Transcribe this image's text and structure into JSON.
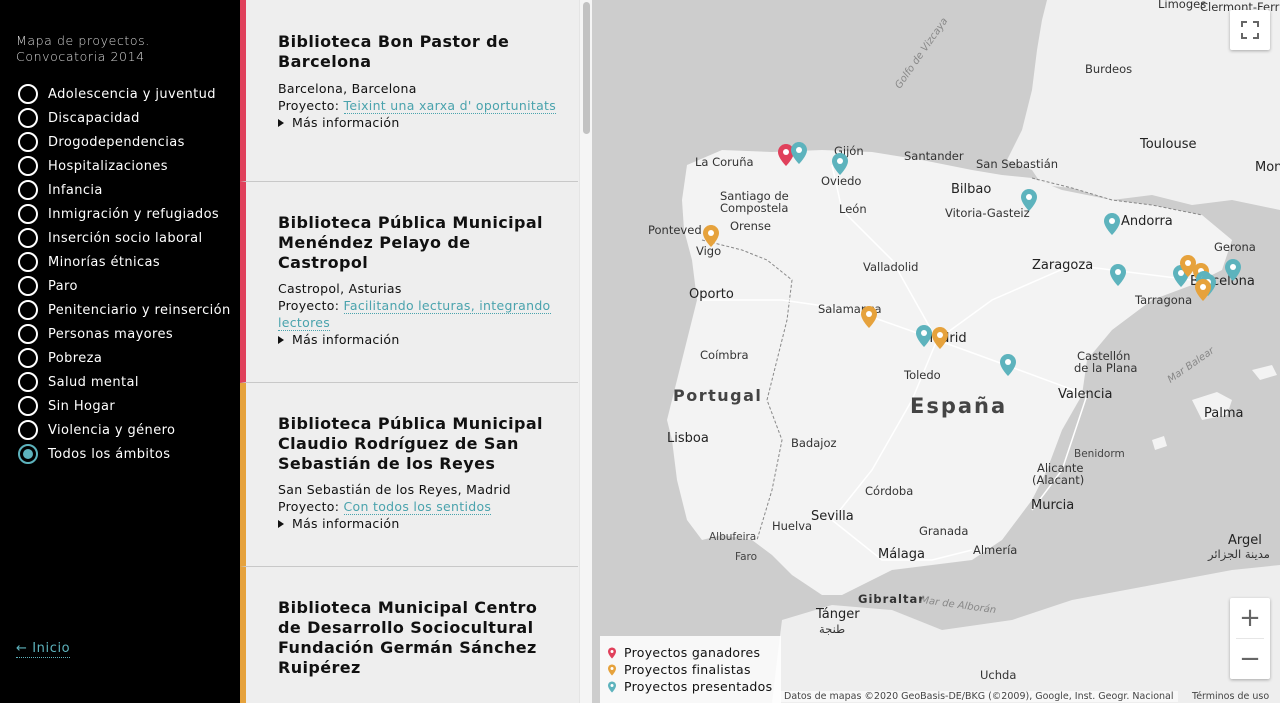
{
  "sidebar": {
    "title_line1": "Mapa de proyectos.",
    "title_line2": "Convocatoria 2014",
    "filters": [
      {
        "label": "Adolescencia y juventud",
        "checked": false
      },
      {
        "label": "Discapacidad",
        "checked": false
      },
      {
        "label": "Drogodependencias",
        "checked": false
      },
      {
        "label": "Hospitalizaciones",
        "checked": false
      },
      {
        "label": "Infancia",
        "checked": false
      },
      {
        "label": "Inmigración y refugiados",
        "checked": false
      },
      {
        "label": "Inserción socio laboral",
        "checked": false
      },
      {
        "label": "Minorías étnicas",
        "checked": false
      },
      {
        "label": "Paro",
        "checked": false
      },
      {
        "label": "Penitenciario y reinserción",
        "checked": false
      },
      {
        "label": "Personas mayores",
        "checked": false
      },
      {
        "label": "Pobreza",
        "checked": false
      },
      {
        "label": "Salud mental",
        "checked": false
      },
      {
        "label": "Sin Hogar",
        "checked": false
      },
      {
        "label": "Violencia y género",
        "checked": false
      },
      {
        "label": "Todos los ámbitos",
        "checked": true
      }
    ],
    "home_link": "← Inicio"
  },
  "cards": [
    {
      "title": "Biblioteca Bon Pastor de Barcelona",
      "place": "Barcelona, Barcelona",
      "project_prefix": "Proyecto: ",
      "project_name": "Teixint una xarxa d' oportunitats",
      "more": "Más información",
      "status": "ganador",
      "status_color": "#e0405b"
    },
    {
      "title": "Biblioteca Pública Municipal Menéndez Pelayo de Castropol",
      "place": "Castropol, Asturias",
      "project_prefix": "Proyecto: ",
      "project_name": "Facilitando lecturas, integrando lectores",
      "more": "Más información",
      "status": "ganador",
      "status_color": "#e0405b"
    },
    {
      "title": "Biblioteca Pública Municipal Claudio Rodríguez de San Sebastián de los Reyes",
      "place": "San Sebastián de los Reyes, Madrid",
      "project_prefix": "Proyecto: ",
      "project_name": "Con todos los sentidos",
      "more": "Más información",
      "status": "finalista",
      "status_color": "#e6a23c"
    },
    {
      "title": "Biblioteca Municipal Centro de Desarrollo Sociocultural Fundación Germán Sánchez Ruipérez",
      "place": "",
      "project_prefix": "",
      "project_name": "",
      "more": "",
      "status": "finalista",
      "status_color": "#e6a23c"
    }
  ],
  "map": {
    "labels": {
      "limoges": "Limoges",
      "clermont": "Clermont-Ferrand",
      "bordeaux": "Burdeos",
      "golfo": "Golfo de Vizcaya",
      "toulouse": "Toulouse",
      "montpellier": "Mont",
      "gijon": "Gijón",
      "oviedo": "Oviedo",
      "santander": "Santander",
      "sansebastian": "San Sebastián",
      "lacoruna": "La Coruña",
      "santiago1": "Santiago de",
      "santiago2": "Compostela",
      "bilbao": "Bilbao",
      "vitoria": "Vitoria-Gasteiz",
      "leon": "León",
      "andorra": "Andorra",
      "orense": "Orense",
      "pontevedra": "Ponteved",
      "vigo": "Vigo",
      "gerona": "Gerona",
      "valladolid": "Valladolid",
      "zaragoza": "Zaragoza",
      "barcelona": "Barcelona",
      "oporto": "Oporto",
      "tarragona": "Tarragona",
      "salamanca": "Salamanca",
      "madrid": "Madrid",
      "coimbra": "Coímbra",
      "castellon1": "Castellón",
      "castellon2": "de la Plana",
      "marbalear": "Mar Balear",
      "toledo": "Toledo",
      "portugal": "Portugal",
      "espana": "España",
      "valencia": "Valencia",
      "palma": "Palma",
      "lisboa": "Lisboa",
      "badajoz": "Badajoz",
      "benidorm": "Benidorm",
      "alicante1": "Alicante",
      "alicante2": "(Alacant)",
      "cordoba": "Córdoba",
      "murcia": "Murcia",
      "sevilla": "Sevilla",
      "albufeira": "Albufeira",
      "faro": "Faro",
      "huelva": "Huelva",
      "granada": "Granada",
      "malaga": "Málaga",
      "almeria": "Almería",
      "argel1": "Argel",
      "argel2": "مدينة الجزائر",
      "gibraltar": "Gibraltar",
      "maralboran": "Mar de Alborán",
      "tanger1": "Tánger",
      "tanger2": "طنجة",
      "uchda": "Uchda"
    },
    "legend": [
      {
        "label": "Proyectos ganadores",
        "color": "#e0405b"
      },
      {
        "label": "Proyectos finalistas",
        "color": "#e6a23c"
      },
      {
        "label": "Proyectos presentados",
        "color": "#5db3bd"
      }
    ],
    "attribution": "Datos de mapas ©2020 GeoBasis-DE/BKG (©2009), Google, Inst. Geogr. Nacional",
    "terms": "Términos de uso",
    "zoom_in": "+",
    "zoom_out": "−",
    "colors": {
      "ganador": "#e0405b",
      "finalista": "#e6a23c",
      "presentado": "#5db3bd"
    }
  }
}
